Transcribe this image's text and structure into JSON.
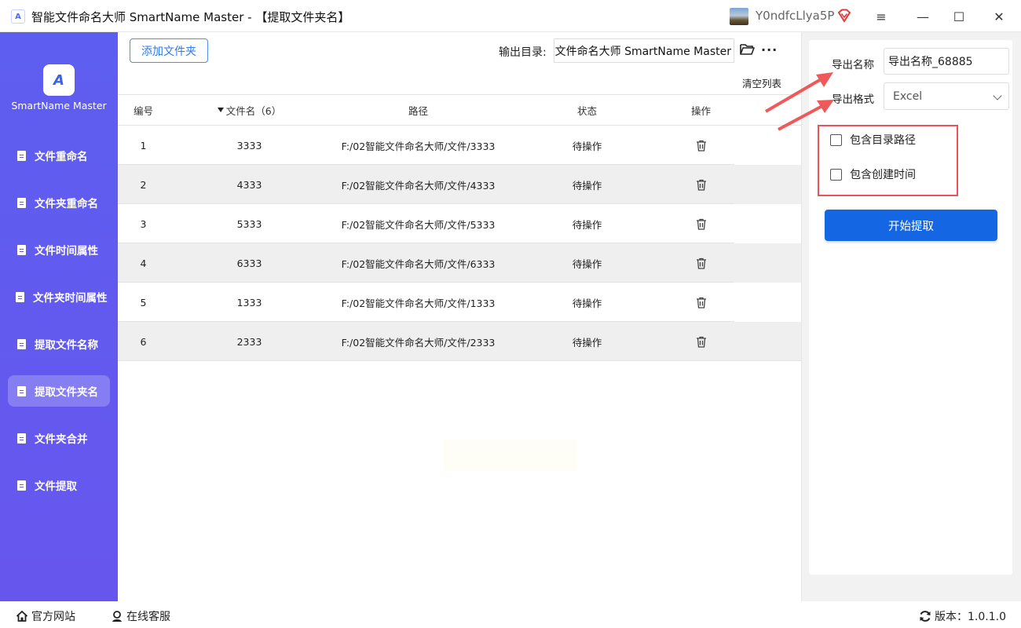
{
  "window": {
    "app_icon": "A",
    "title": "智能文件命名大师 SmartName Master - 【提取文件夹名】",
    "user_name": "Y0ndfcLlya5P",
    "vip_icon": "vip-diamond-icon",
    "menu_icon": "≡",
    "minimize_icon": "—",
    "maximize_icon": "☐",
    "close_icon": "✕"
  },
  "sidebar": {
    "logo_text": "A",
    "brand": "SmartName Master",
    "items": [
      {
        "label": "文件重命名"
      },
      {
        "label": "文件夹重命名"
      },
      {
        "label": "文件时间属性"
      },
      {
        "label": "文件夹时间属性"
      },
      {
        "label": "提取文件名称"
      },
      {
        "label": "提取文件夹名"
      },
      {
        "label": "文件夹合并"
      },
      {
        "label": "文件提取"
      }
    ],
    "active_index": 5
  },
  "toolbar": {
    "add_folder_label": "添加文件夹",
    "output_label": "输出目录:",
    "output_value": "能文件命名大师 SmartName Master",
    "more_label": "···",
    "clear_list_label": "清空列表"
  },
  "table": {
    "headers": {
      "no": "编号",
      "name": "文件名（6）",
      "path": "路径",
      "status": "状态",
      "op": "操作"
    },
    "rows": [
      {
        "no": "1",
        "name": "3333",
        "path": "F:/02智能文件命名大师/文件/3333",
        "status": "待操作"
      },
      {
        "no": "2",
        "name": "4333",
        "path": "F:/02智能文件命名大师/文件/4333",
        "status": "待操作"
      },
      {
        "no": "3",
        "name": "5333",
        "path": "F:/02智能文件命名大师/文件/5333",
        "status": "待操作"
      },
      {
        "no": "4",
        "name": "6333",
        "path": "F:/02智能文件命名大师/文件/6333",
        "status": "待操作"
      },
      {
        "no": "5",
        "name": "1333",
        "path": "F:/02智能文件命名大师/文件/1333",
        "status": "待操作"
      },
      {
        "no": "6",
        "name": "2333",
        "path": "F:/02智能文件命名大师/文件/2333",
        "status": "待操作"
      }
    ]
  },
  "panel": {
    "export_name_label": "导出名称",
    "export_name_value": "导出名称_68885",
    "export_format_label": "导出格式",
    "export_format_value": "Excel",
    "include_path_label": "包含目录路径",
    "include_time_label": "包含创建时间",
    "start_label": "开始提取",
    "highlight_color": "#e9535c",
    "primary_color": "#1466e2"
  },
  "bottom": {
    "website_label": "官方网站",
    "service_label": "在线客服",
    "version_label": "版本：1.0.1.0"
  }
}
